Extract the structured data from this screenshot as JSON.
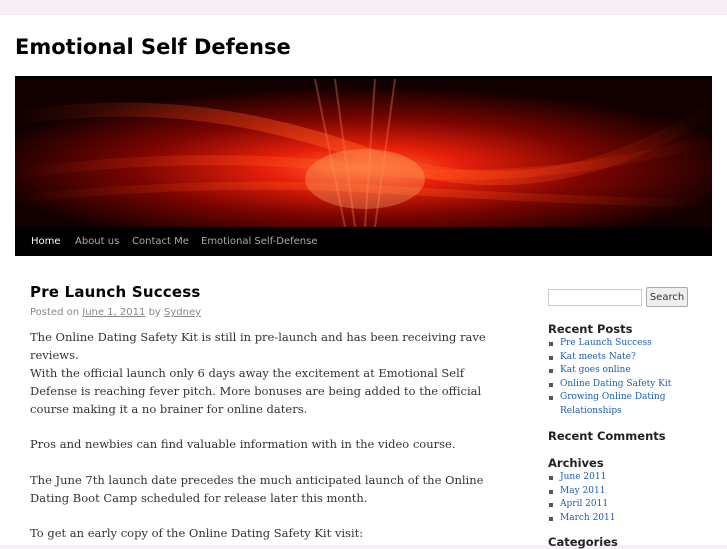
{
  "site": {
    "title": "Emotional Self Defense"
  },
  "nav": {
    "items": [
      {
        "label": "Home",
        "current": true
      },
      {
        "label": "About us",
        "current": false
      },
      {
        "label": "Contact Me",
        "current": false
      },
      {
        "label": "Emotional Self-Defense",
        "current": false
      }
    ]
  },
  "post": {
    "title": "Pre Launch Success",
    "posted_on": "Posted on",
    "date": "June 1, 2011",
    "by": "by",
    "author": "Sydney",
    "paragraphs": [
      "The Online Dating Safety Kit is still in pre-launch and has been receiving rave reviews.",
      "With the official launch only 6 days away the excitement at Emotional Self Defense is reaching fever pitch. More bonuses are being added to the official course making it a no brainer for online daters.",
      "Pros and newbies can find valuable information with in the video course.",
      "The June 7th launch date precedes the much anticipated launch of the Online Dating Boot Camp scheduled for release later this month.",
      "To get an early copy of the Online Dating Safety Kit visit:"
    ]
  },
  "sidebar": {
    "search": {
      "placeholder": "",
      "button_label": "Search"
    },
    "recent_posts": {
      "title": "Recent Posts",
      "items": [
        "Pre Launch Success",
        "Kat meets Nate?",
        "Kat goes online",
        "Online Dating Safety Kit",
        "Growing Online Dating Relationships"
      ]
    },
    "recent_comments": {
      "title": "Recent Comments"
    },
    "archives": {
      "title": "Archives",
      "items": [
        "June 2011",
        "May 2011",
        "April 2011",
        "March 2011"
      ]
    },
    "categories": {
      "title": "Categories"
    }
  },
  "colors": {
    "page_bg": "#f6eef5",
    "menu_bg": "#000000",
    "link": "#1b5db5",
    "banner_red": "#e8200a"
  }
}
